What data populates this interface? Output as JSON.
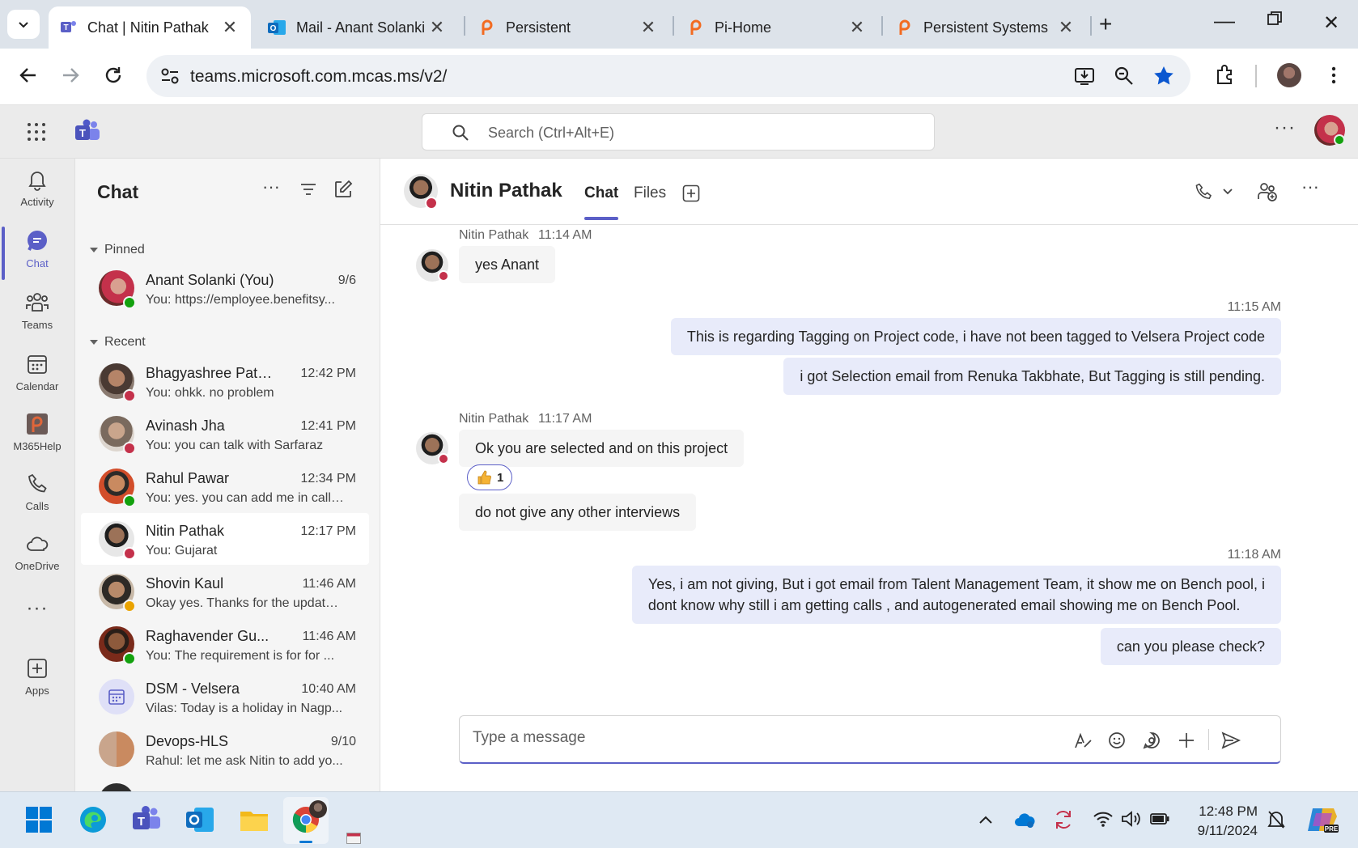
{
  "browser": {
    "tabs": [
      {
        "title": "Chat | Nitin Pathak"
      },
      {
        "title": "Mail - Anant Solanki"
      },
      {
        "title": "Persistent"
      },
      {
        "title": "Pi-Home"
      },
      {
        "title": "Persistent Systems"
      }
    ],
    "url": "teams.microsoft.com.mcas.ms/v2/"
  },
  "teams": {
    "search_placeholder": "Search (Ctrl+Alt+E)"
  },
  "rail": {
    "items": [
      {
        "label": "Activity"
      },
      {
        "label": "Chat"
      },
      {
        "label": "Teams"
      },
      {
        "label": "Calendar"
      },
      {
        "label": "M365Help"
      },
      {
        "label": "Calls"
      },
      {
        "label": "OneDrive"
      },
      {
        "label": "Apps"
      }
    ]
  },
  "chatlist": {
    "title": "Chat",
    "pinned_label": "Pinned",
    "recent_label": "Recent",
    "pinned": [
      {
        "name": "Anant Solanki (You)",
        "time": "9/6",
        "preview": "You: https://employee.benefitsy..."
      }
    ],
    "recent": [
      {
        "name": "Bhagyashree Pate...",
        "time": "12:42 PM",
        "preview": "You: ohkk. no problem"
      },
      {
        "name": "Avinash Jha",
        "time": "12:41 PM",
        "preview": "You: you can talk with Sarfaraz"
      },
      {
        "name": "Rahul Pawar",
        "time": "12:34 PM",
        "preview": "You: yes. you can add me in call ..."
      },
      {
        "name": "Nitin Pathak",
        "time": "12:17 PM",
        "preview": "You: Gujarat"
      },
      {
        "name": "Shovin Kaul",
        "time": "11:46 AM",
        "preview": "Okay yes. Thanks for the update...."
      },
      {
        "name": "Raghavender Gu...",
        "time": "11:46 AM",
        "preview": "You: The requirement is for for ..."
      },
      {
        "name": "DSM - Velsera",
        "time": "10:40 AM",
        "preview": "Vilas: Today is a holiday in Nagp..."
      },
      {
        "name": "Devops-HLS",
        "time": "9/10",
        "preview": "Rahul: let me ask Nitin to add yo..."
      }
    ]
  },
  "conversation": {
    "name": "Nitin Pathak",
    "tabs": {
      "chat": "Chat",
      "files": "Files"
    },
    "messages": {
      "m1_sender": "Nitin Pathak",
      "m1_time": "11:14 AM",
      "m1_text": "yes Anant",
      "m2_time": "11:15 AM",
      "m2_text": "This is regarding Tagging on Project code, i have not been tagged to Velsera Project code",
      "m3_text": "i got Selection email from Renuka Takbhate, But Tagging is still pending.",
      "m4_sender": "Nitin Pathak",
      "m4_time": "11:17 AM",
      "m4_text": "Ok you are selected and on this project",
      "m4_reaction_count": "1",
      "m5_text": "do not give any other interviews",
      "m6_time": "11:18 AM",
      "m6_line1": "Yes, i am not giving, But i got email from Talent Management Team, it show me on Bench pool, i",
      "m6_line2": "dont know why still i am getting calls , and autogenerated email showing me on Bench Pool.",
      "m7_text": "can you please check?"
    },
    "composer_placeholder": "Type a message"
  },
  "taskbar": {
    "time": "12:48 PM",
    "date": "9/11/2024"
  },
  "colors": {
    "brand": "#5b5fc7",
    "busy": "#c4314b",
    "available": "#13a10e",
    "away": "#eaa300"
  }
}
